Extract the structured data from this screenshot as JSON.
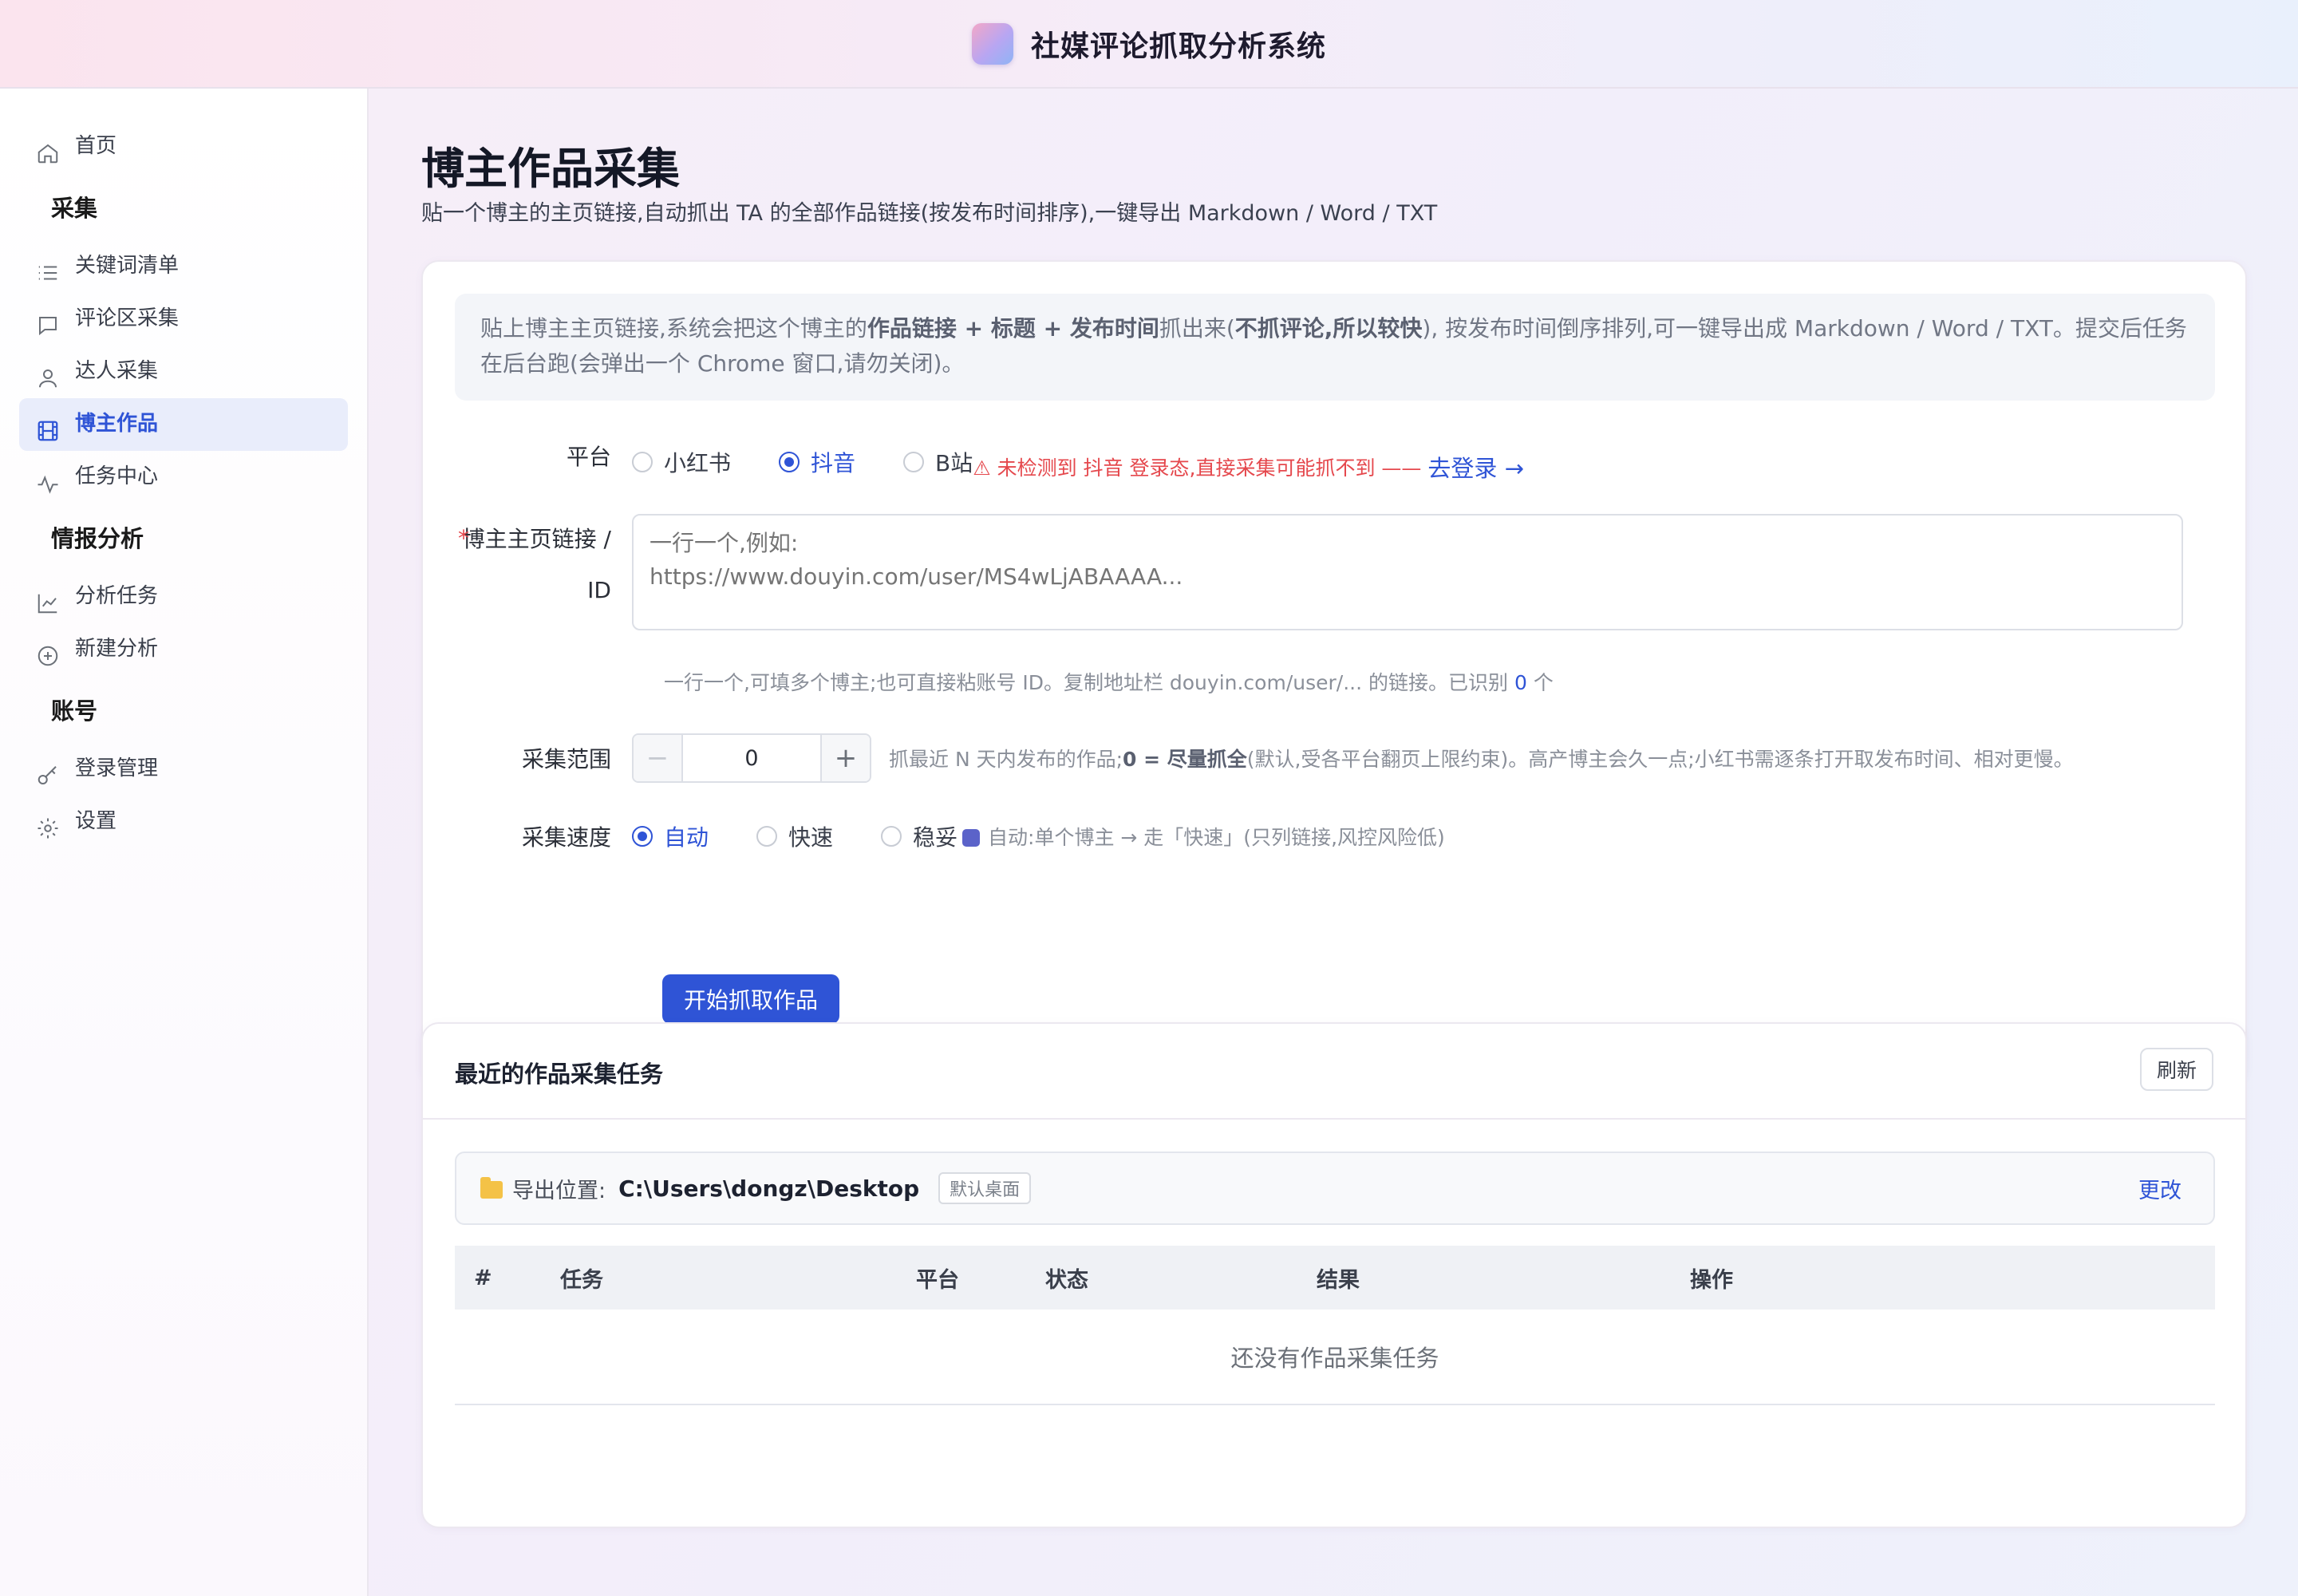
{
  "app": {
    "title": "社媒评论抓取分析系统"
  },
  "sidebar": {
    "home": "首页",
    "group_collect": "采集",
    "collect_items": [
      "关键词清单",
      "评论区采集",
      "达人采集",
      "博主作品",
      "任务中心"
    ],
    "group_analysis": "情报分析",
    "analysis_items": [
      "分析任务",
      "新建分析"
    ],
    "group_account": "账号",
    "account_items": [
      "登录管理",
      "设置"
    ]
  },
  "page": {
    "title": "博主作品采集",
    "subtitle": "贴一个博主的主页链接,自动抓出 TA 的全部作品链接(按发布时间排序),一键导出 Markdown / Word / TXT"
  },
  "notice": {
    "p1": "贴上博主主页链接,系统会把这个博主的",
    "b1": "作品链接 + 标题 + 发布时间",
    "p2": "抓出来(",
    "b2": "不抓评论,所以较快",
    "p3": "), 按发布时间倒序排列,可一键导出成 Markdown / Word / TXT。提交后任务在后台跑(会弹出一个 Chrome 窗口,请勿关闭)。"
  },
  "form": {
    "platform_label": "平台",
    "platforms": [
      "小红书",
      "抖音",
      "B站"
    ],
    "platform_selected": "抖音",
    "platform_warning": "⚠ 未检测到 抖音 登录态,直接采集可能抓不到 ——",
    "login_link": "去登录 →",
    "required_mark": "*",
    "url_label_line1": "博主主页链接 /",
    "url_label_line2": "ID",
    "url_placeholder": "一行一个,例如:\nhttps://www.douyin.com/user/MS4wLjABAAAA...",
    "url_hint": "一行一个,可填多个博主;也可直接粘账号 ID。复制地址栏 douyin.com/user/... 的链接。已识别",
    "url_count": "0",
    "url_count_unit": "个",
    "range_label": "采集范围",
    "range_value": "0",
    "range_minus": "−",
    "range_plus": "+",
    "range_hint_a": "抓最近 N 天内发布的作品;",
    "range_hint_b": "0 = 尽量抓全",
    "range_hint_c": "(默认,受各平台翻页上限约束)。高产博主会久一点;小红书需逐条打开取发布时间、相对更慢。",
    "speed_label": "采集速度",
    "speeds": [
      "自动",
      "快速",
      "稳妥"
    ],
    "speed_selected": "自动",
    "speed_hint": "自动:单个博主 → 走「快速」(只列链接,风控风险低)",
    "submit": "开始抓取作品"
  },
  "tasks": {
    "title": "最近的作品采集任务",
    "refresh": "刷新",
    "export_label": "导出位置:",
    "export_path": "C:\\Users\\dongz\\Desktop",
    "export_tag": "默认桌面",
    "change": "更改",
    "columns": [
      "#",
      "任务",
      "平台",
      "状态",
      "结果",
      "操作"
    ],
    "empty": "还没有作品采集任务"
  },
  "colors": {
    "accent": "#2f54d6",
    "danger": "#e5484d"
  }
}
